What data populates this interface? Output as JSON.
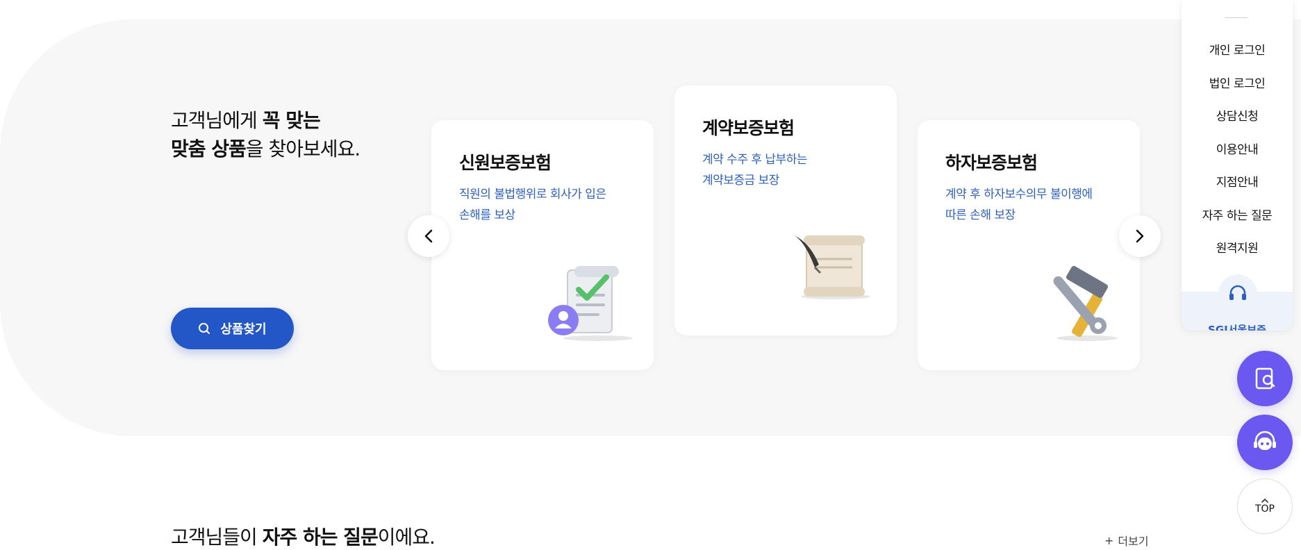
{
  "hero": {
    "headline_part1": "고객님에게 ",
    "headline_bold1": "꼭 맞는",
    "headline_bold2": "맞춤 상품",
    "headline_part2": "을 찾아보세요.",
    "find_button": "상품찾기"
  },
  "cards": [
    {
      "title": "신원보증보험",
      "desc_line1": "직원의 불법행위로 회사가 입은",
      "desc_line2": "손해를 보상",
      "icon": "document-check-user-icon"
    },
    {
      "title": "계약보증보험",
      "desc_line1": "계약 수주 후 납부하는",
      "desc_line2": "계약보증금 보장",
      "icon": "scroll-quill-icon"
    },
    {
      "title": "하자보증보험",
      "desc_line1": "계약 후 하자보수의무 불이행에",
      "desc_line2": "따른 손해 보장",
      "icon": "hammer-wrench-icon"
    }
  ],
  "quick_menu": {
    "items": [
      "개인 로그인",
      "법인 로그인",
      "상담신청",
      "이용안내",
      "지점안내",
      "자주 하는 질문",
      "원격지원"
    ],
    "footer_label": "SGI서울보증"
  },
  "floating": {
    "top_label": "TOP"
  },
  "faq": {
    "title_part1": "고객님들이 ",
    "title_bold": "자주 하는 질문",
    "title_part2": "이에요.",
    "more_label": "더보기"
  },
  "colors": {
    "brand_blue": "#2357c7",
    "desc_blue": "#2c5fbf",
    "fab_purple": "#6a58f1",
    "hero_bg": "#f7f7f7"
  }
}
